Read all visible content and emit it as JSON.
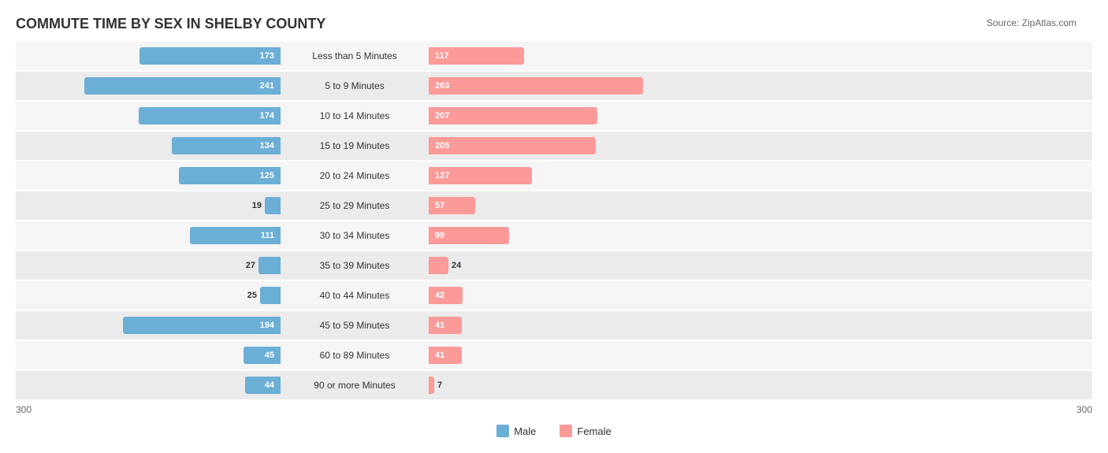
{
  "title": "COMMUTE TIME BY SEX IN SHELBY COUNTY",
  "source": "Source: ZipAtlas.com",
  "colors": {
    "male": "#6baed6",
    "female": "#fb9a99"
  },
  "axis": {
    "left": "300",
    "right": "300"
  },
  "legend": {
    "male": "Male",
    "female": "Female"
  },
  "maxBarWidth": 320,
  "maxValue": 300,
  "rows": [
    {
      "label": "Less than 5 Minutes",
      "male": 173,
      "female": 117
    },
    {
      "label": "5 to 9 Minutes",
      "male": 241,
      "female": 263
    },
    {
      "label": "10 to 14 Minutes",
      "male": 174,
      "female": 207
    },
    {
      "label": "15 to 19 Minutes",
      "male": 134,
      "female": 205
    },
    {
      "label": "20 to 24 Minutes",
      "male": 125,
      "female": 127
    },
    {
      "label": "25 to 29 Minutes",
      "male": 19,
      "female": 57
    },
    {
      "label": "30 to 34 Minutes",
      "male": 111,
      "female": 99
    },
    {
      "label": "35 to 39 Minutes",
      "male": 27,
      "female": 24
    },
    {
      "label": "40 to 44 Minutes",
      "male": 25,
      "female": 42
    },
    {
      "label": "45 to 59 Minutes",
      "male": 194,
      "female": 41
    },
    {
      "label": "60 to 89 Minutes",
      "male": 45,
      "female": 41
    },
    {
      "label": "90 or more Minutes",
      "male": 44,
      "female": 7
    }
  ]
}
